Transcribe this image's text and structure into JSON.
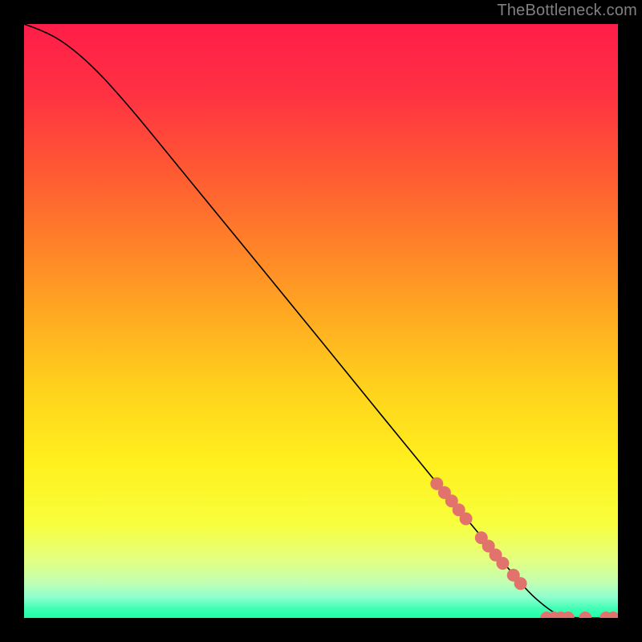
{
  "attribution": "TheBottleneck.com",
  "chart_data": {
    "type": "line",
    "title": "",
    "xlabel": "",
    "ylabel": "",
    "xlim": [
      0,
      100
    ],
    "ylim": [
      0,
      100
    ],
    "grid": false,
    "legend": false,
    "background_gradient": {
      "stops": [
        {
          "pos": 0.0,
          "color": "#ff1d49"
        },
        {
          "pos": 0.12,
          "color": "#ff3242"
        },
        {
          "pos": 0.25,
          "color": "#ff5a33"
        },
        {
          "pos": 0.38,
          "color": "#ff8428"
        },
        {
          "pos": 0.5,
          "color": "#ffad21"
        },
        {
          "pos": 0.62,
          "color": "#ffd41c"
        },
        {
          "pos": 0.74,
          "color": "#fff01e"
        },
        {
          "pos": 0.84,
          "color": "#f8ff3c"
        },
        {
          "pos": 0.9,
          "color": "#e5ff7e"
        },
        {
          "pos": 0.94,
          "color": "#c3ffb2"
        },
        {
          "pos": 0.965,
          "color": "#8effce"
        },
        {
          "pos": 0.985,
          "color": "#3effb4"
        },
        {
          "pos": 1.0,
          "color": "#1dffa8"
        }
      ]
    },
    "series": [
      {
        "name": "curve",
        "points": [
          {
            "x": 0.0,
            "y": 100.0
          },
          {
            "x": 3.0,
            "y": 99.0
          },
          {
            "x": 7.0,
            "y": 96.8
          },
          {
            "x": 12.0,
            "y": 92.5
          },
          {
            "x": 18.0,
            "y": 85.8
          },
          {
            "x": 25.0,
            "y": 77.2
          },
          {
            "x": 35.0,
            "y": 65.0
          },
          {
            "x": 45.0,
            "y": 52.8
          },
          {
            "x": 55.0,
            "y": 40.5
          },
          {
            "x": 65.0,
            "y": 28.2
          },
          {
            "x": 72.0,
            "y": 19.7
          },
          {
            "x": 78.0,
            "y": 12.5
          },
          {
            "x": 82.0,
            "y": 7.8
          },
          {
            "x": 85.0,
            "y": 4.3
          },
          {
            "x": 87.5,
            "y": 2.1
          },
          {
            "x": 89.5,
            "y": 0.7
          },
          {
            "x": 91.0,
            "y": 0.0
          },
          {
            "x": 100.0,
            "y": 0.0
          }
        ]
      }
    ],
    "markers": {
      "name": "highlighted-points",
      "color": "#e2736c",
      "radius": 8,
      "points": [
        {
          "x": 69.5,
          "y": 22.6
        },
        {
          "x": 70.8,
          "y": 21.1
        },
        {
          "x": 72.0,
          "y": 19.7
        },
        {
          "x": 73.2,
          "y": 18.2
        },
        {
          "x": 74.4,
          "y": 16.7
        },
        {
          "x": 77.0,
          "y": 13.5
        },
        {
          "x": 78.2,
          "y": 12.1
        },
        {
          "x": 79.4,
          "y": 10.6
        },
        {
          "x": 80.6,
          "y": 9.2
        },
        {
          "x": 82.4,
          "y": 7.2
        },
        {
          "x": 83.6,
          "y": 5.8
        },
        {
          "x": 88.0,
          "y": 0.0
        },
        {
          "x": 89.2,
          "y": 0.0
        },
        {
          "x": 90.4,
          "y": 0.0
        },
        {
          "x": 91.6,
          "y": 0.0
        },
        {
          "x": 94.5,
          "y": 0.0
        },
        {
          "x": 98.0,
          "y": 0.0
        },
        {
          "x": 99.2,
          "y": 0.0
        }
      ]
    }
  }
}
